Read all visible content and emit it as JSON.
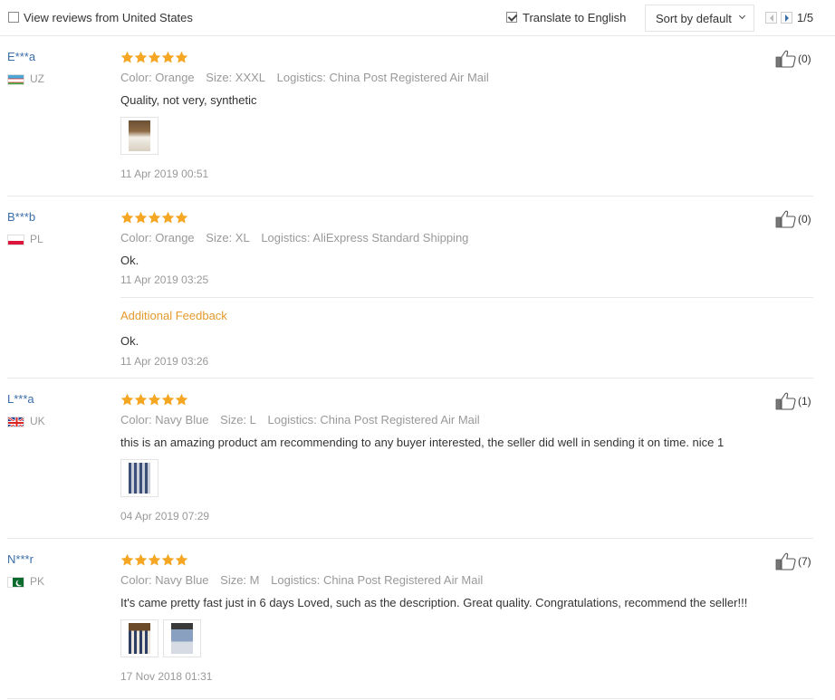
{
  "toolbar": {
    "view_us_label": "View reviews from United States",
    "view_us_checked": false,
    "translate_label": "Translate to English",
    "translate_checked": true,
    "sort_label": "Sort by default",
    "page_indicator": "1/5"
  },
  "colors": {
    "star": "#f5a623",
    "link": "#3b6ea8",
    "feedback": "#e49a2d",
    "muted": "#999999"
  },
  "reviews": [
    {
      "user": "E***a",
      "country": "UZ",
      "flag": "uz-flag-icon",
      "stars": 5,
      "color": "Color: Orange",
      "size": "Size: XXXL",
      "logistics": "Logistics: China Post Registered Air Mail",
      "text": "Quality, not very, synthetic",
      "photos": 1,
      "date": "11 Apr 2019 00:51",
      "helpful": "(0)"
    },
    {
      "user": "B***b",
      "country": "PL",
      "flag": "pl-flag-icon",
      "stars": 5,
      "color": "Color: Orange",
      "size": "Size: XL",
      "logistics": "Logistics: AliExpress Standard Shipping",
      "text": "Ok.",
      "photos": 0,
      "date": "11 Apr 2019 03:25",
      "helpful": "(0)",
      "additional": {
        "title": "Additional Feedback",
        "text": "Ok.",
        "date": "11 Apr 2019 03:26"
      }
    },
    {
      "user": "L***a",
      "country": "UK",
      "flag": "uk-flag-icon",
      "stars": 5,
      "color": "Color: Navy Blue",
      "size": "Size: L",
      "logistics": "Logistics: China Post Registered Air Mail",
      "text": "this is an amazing product am recommending to any buyer interested, the seller did well in sending it on time. nice 1",
      "photos": 1,
      "date": "04 Apr 2019 07:29",
      "helpful": "(1)"
    },
    {
      "user": "N***r",
      "country": "PK",
      "flag": "pk-flag-icon",
      "stars": 5,
      "color": "Color: Navy Blue",
      "size": "Size: M",
      "logistics": "Logistics: China Post Registered Air Mail",
      "text": "It's came pretty fast just in 6 days Loved, such as the description. Great quality. Congratulations, recommend the seller!!!",
      "photos": 2,
      "date": "17 Nov 2018 01:31",
      "helpful": "(7)"
    }
  ]
}
